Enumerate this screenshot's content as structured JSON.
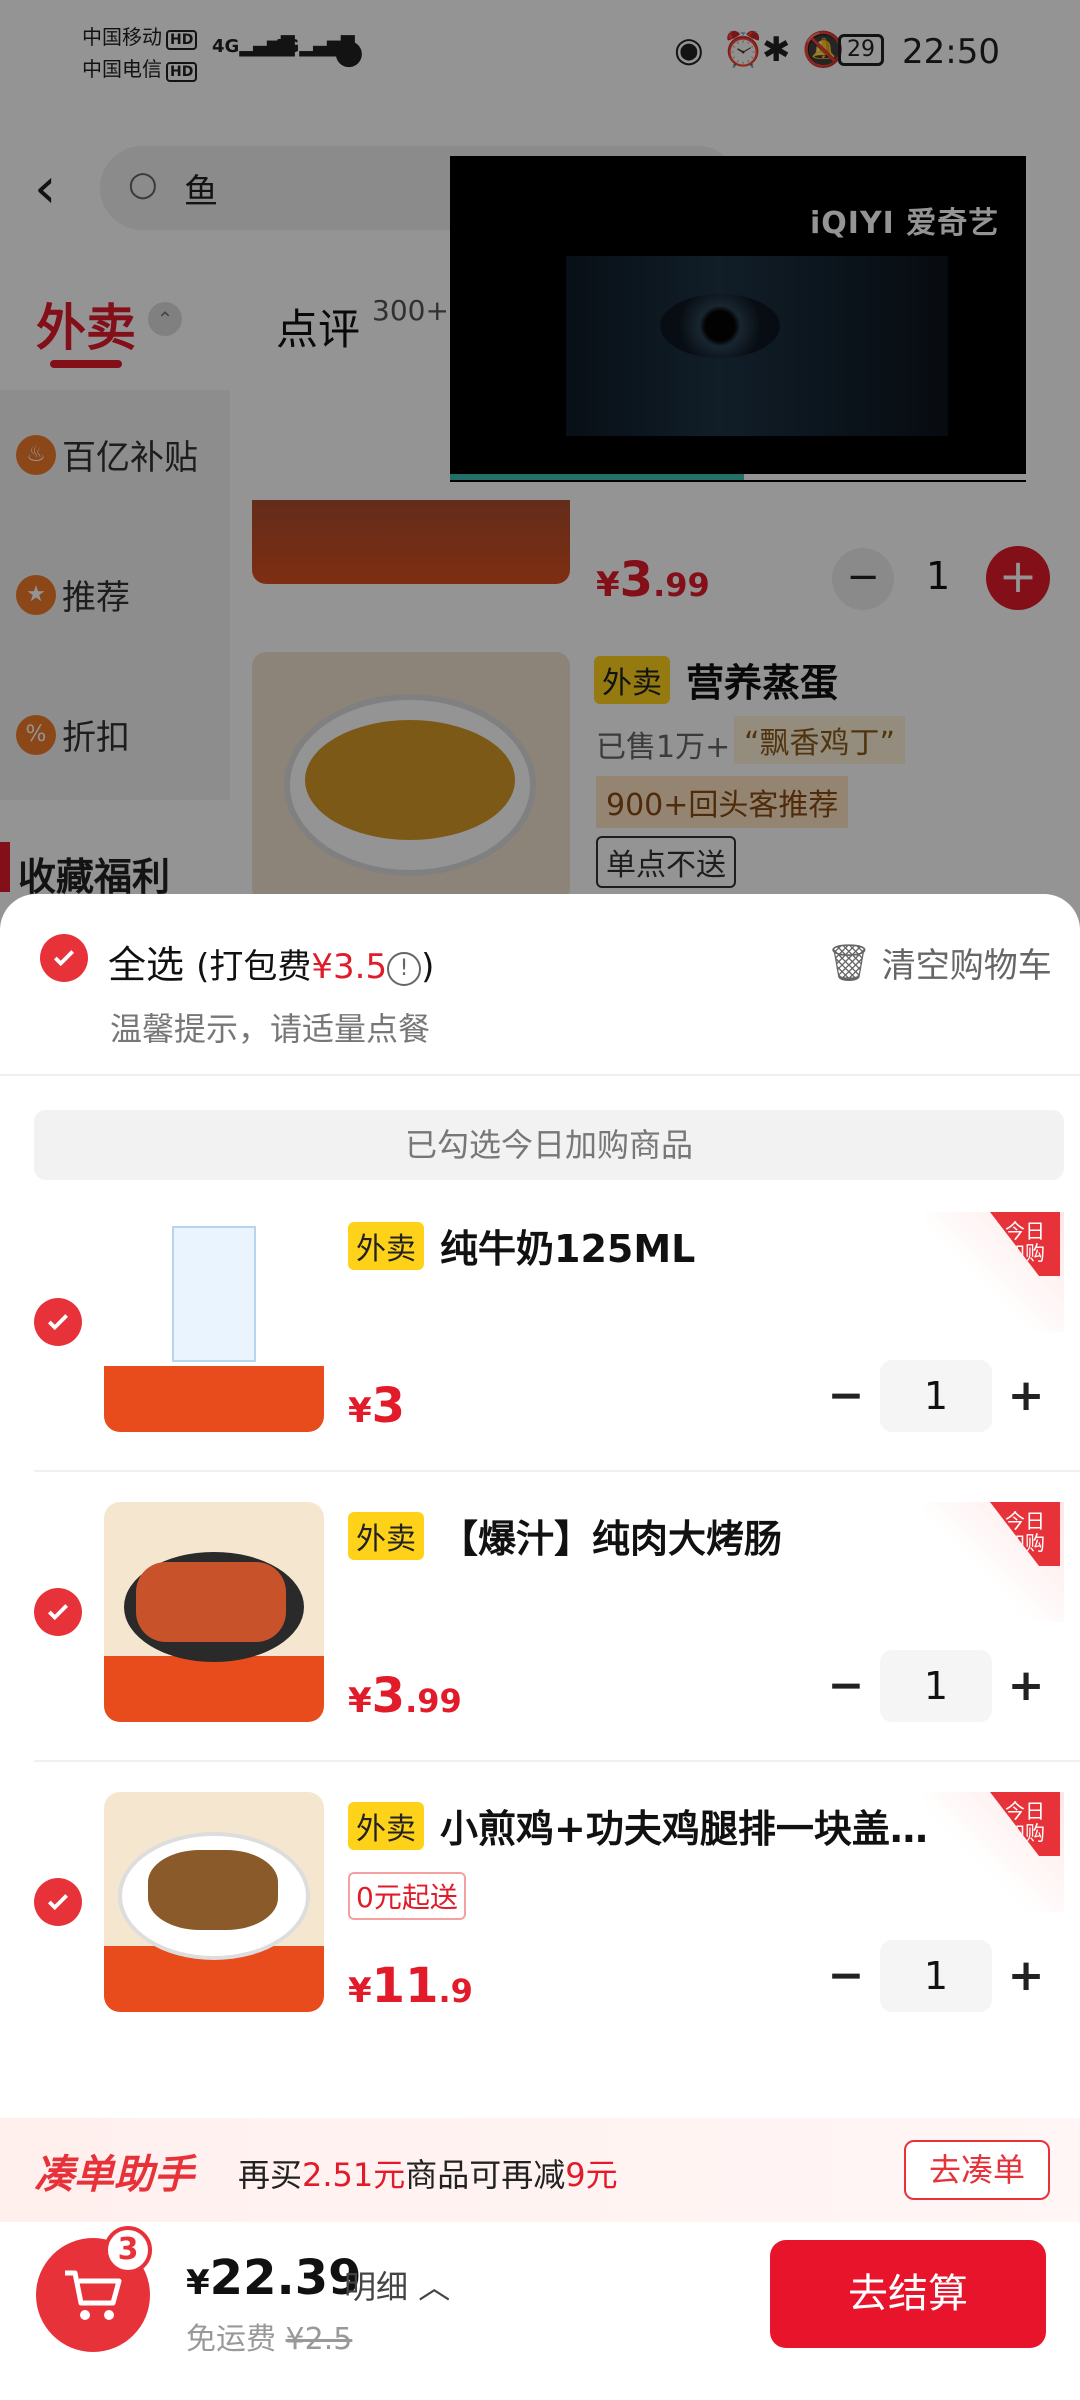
{
  "status_bar": {
    "carrier1": "中国移动",
    "carrier2": "中国电信",
    "hd": "HD",
    "net": "4G",
    "battery": "29",
    "time": "22:50"
  },
  "background": {
    "search_text": "鱼",
    "tab_takeout": "外卖",
    "tab_review": "点评",
    "tab_review_count": "300+",
    "sidebar": [
      "百亿补贴",
      "推荐",
      "折扣"
    ],
    "favorites": "收藏福利",
    "item1": {
      "price_cur": "¥",
      "price_int": "3",
      "price_dec": ".99",
      "qty": "1"
    },
    "item2": {
      "badge": "外卖",
      "title": "营养蒸蛋",
      "sold": "已售1万+",
      "tag": "“飘香鸡丁”",
      "repeat": "900+回头客推荐",
      "no_single": "单点不送"
    }
  },
  "video": {
    "brand": "iQIYI 爱奇艺",
    "progress_percent": 51
  },
  "cart_sheet": {
    "select_all": "全选",
    "pack_fee_label": "(打包费",
    "pack_fee_amount": "¥3.5",
    "pack_fee_close": ")",
    "clear_cart": "清空购物车",
    "tip": "温馨提示，请适量点餐",
    "banner": "已勾选今日加购商品",
    "corner_label": [
      "今日",
      "加购"
    ],
    "items": [
      {
        "badge": "外卖",
        "title": "纯牛奶125ML",
        "price_cur": "¥",
        "price_int": "3",
        "price_dec": "",
        "qty": "1",
        "extra": ""
      },
      {
        "badge": "外卖",
        "title": "【爆汁】纯肉大烤肠",
        "price_cur": "¥",
        "price_int": "3",
        "price_dec": ".99",
        "qty": "1",
        "extra": ""
      },
      {
        "badge": "外卖",
        "title": "小煎鸡+功夫鸡腿排一块盖…",
        "price_cur": "¥",
        "price_int": "11",
        "price_dec": ".9",
        "qty": "1",
        "extra": "0元起送"
      }
    ]
  },
  "helper": {
    "title": "凑单助手",
    "text_a": "再买",
    "amount": "2.51元",
    "text_b": "商品可再减",
    "discount": "9元",
    "button": "去凑单"
  },
  "bottom_bar": {
    "cart_count": "3",
    "total_cur": "¥",
    "total": "22.39",
    "detail": "明细",
    "free_ship_label": "免运费",
    "free_ship_old": "¥2.5",
    "checkout": "去结算"
  },
  "colors": {
    "accent": "#e8323a",
    "badge": "#ffd21a",
    "progress": "#3cc2b4"
  }
}
